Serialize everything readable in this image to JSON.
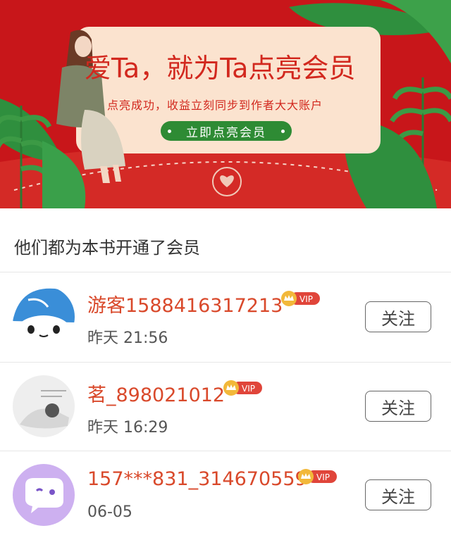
{
  "banner": {
    "headline": "爱Ta，就为Ta点亮会员",
    "subline": "点亮成功，收益立刻同步到作者大大账户",
    "cta_label": "立即点亮会员"
  },
  "section": {
    "title": "他们都为本书开通了会员"
  },
  "members": [
    {
      "name": "游客1588416317213",
      "time": "昨天 21:56",
      "badge": "VIP",
      "follow_label": "关注"
    },
    {
      "name": "茗_898021012",
      "time": "昨天 16:29",
      "badge": "VIP",
      "follow_label": "关注"
    },
    {
      "name": "157***831_314670559",
      "time": "06-05",
      "badge": "VIP",
      "follow_label": "关注"
    }
  ],
  "colors": {
    "banner_red": "#c8161a",
    "name_red": "#d9492b",
    "cta_green": "#2e8b34",
    "vip_red": "#e0453a",
    "crown_gold": "#f2b83a"
  }
}
